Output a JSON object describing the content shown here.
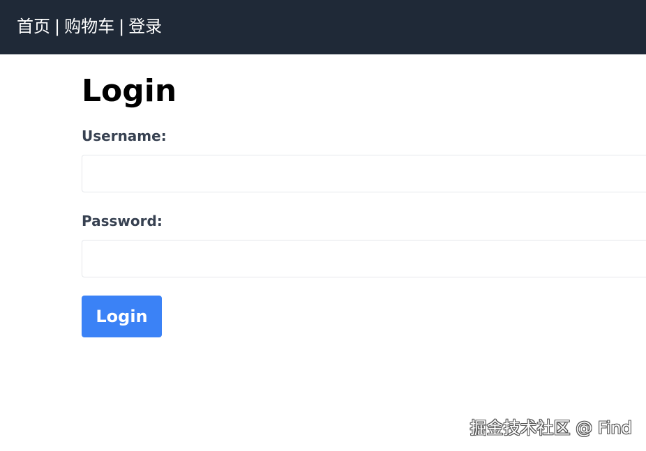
{
  "nav": {
    "links": [
      "首页",
      "购物车",
      "登录"
    ],
    "separator": "|"
  },
  "main": {
    "title": "Login",
    "username_label": "Username:",
    "username_value": "",
    "password_label": "Password:",
    "password_value": "",
    "login_button": "Login"
  },
  "watermark": "掘金技术社区 @ Find",
  "colors": {
    "navbar_bg": "#1f2937",
    "button_bg": "#3b82f6",
    "label_text": "#374151",
    "input_border": "#e5e7eb"
  }
}
